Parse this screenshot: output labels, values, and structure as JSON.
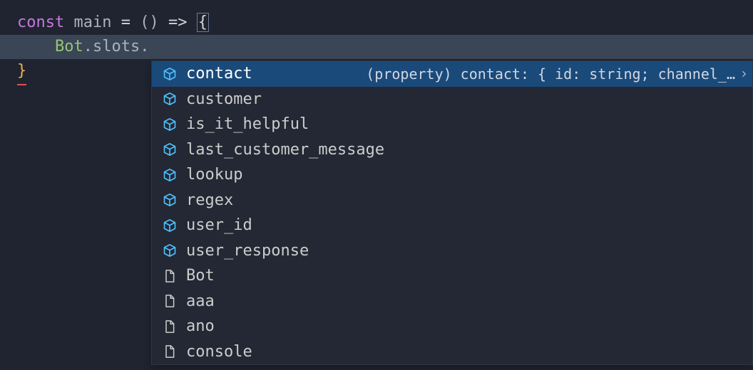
{
  "code": {
    "line1": {
      "const": "const ",
      "name": "main ",
      "eq": "= ",
      "parens": "() ",
      "arrow": "=> ",
      "brace": "{"
    },
    "line2": {
      "indent": "    ",
      "obj": "Bot",
      "dot1": ".",
      "prop": "slots",
      "dot2": "."
    },
    "line3": {
      "brace": "}"
    }
  },
  "suggest": {
    "selectedDetail": "(property) contact: { id: string; channel_…",
    "items": [
      {
        "label": "contact",
        "kind": "property",
        "selected": true
      },
      {
        "label": "customer",
        "kind": "property"
      },
      {
        "label": "is_it_helpful",
        "kind": "property"
      },
      {
        "label": "last_customer_message",
        "kind": "property"
      },
      {
        "label": "lookup",
        "kind": "property"
      },
      {
        "label": "regex",
        "kind": "property"
      },
      {
        "label": "user_id",
        "kind": "property"
      },
      {
        "label": "user_response",
        "kind": "property"
      },
      {
        "label": "Bot",
        "kind": "text"
      },
      {
        "label": "aaa",
        "kind": "text"
      },
      {
        "label": "ano",
        "kind": "text"
      },
      {
        "label": "console",
        "kind": "text"
      }
    ]
  }
}
